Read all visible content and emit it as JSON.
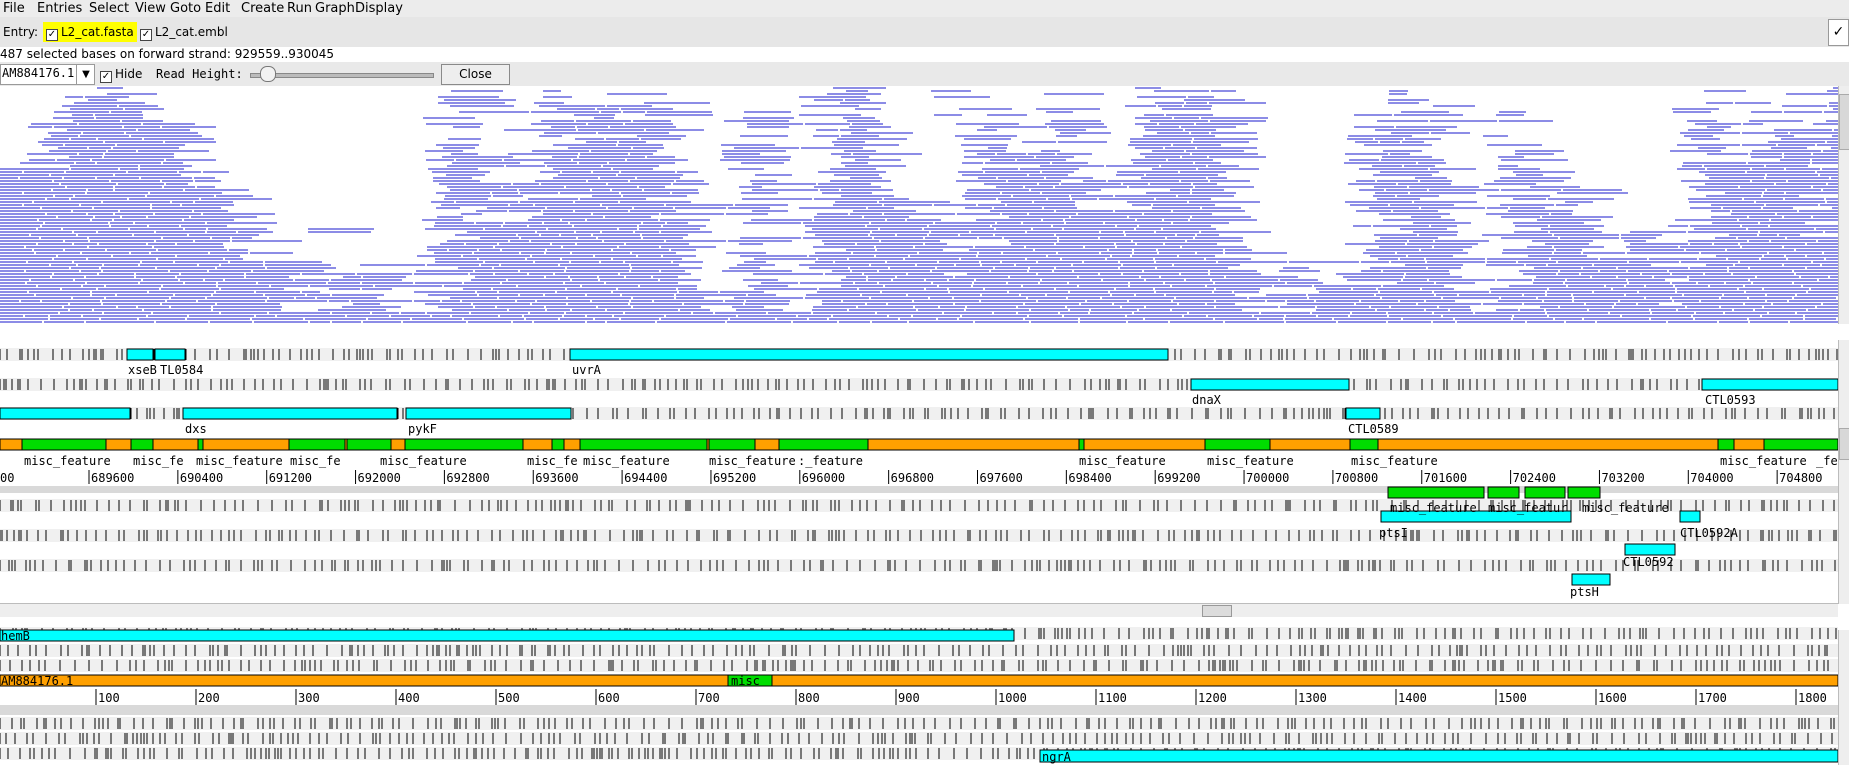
{
  "menu": [
    "File",
    "Entries",
    "Select",
    "View",
    "Goto",
    "Edit",
    "Create",
    "Run",
    "Graph",
    "Display"
  ],
  "entry_bar": {
    "label": "Entry:",
    "entries": [
      {
        "name": "L2_cat.fasta",
        "checked": true,
        "highlight": "#ffff00"
      },
      {
        "name": "L2_cat.embl",
        "checked": true,
        "highlight": ""
      }
    ]
  },
  "status": "487 selected bases on forward strand: 929559..930045",
  "bam_controls": {
    "sequence": "AM884176.1",
    "hide_label": "Hide",
    "hide_checked": true,
    "read_height_label": "Read Height:",
    "close_label": "Close"
  },
  "colors": {
    "cds": "#00ffff",
    "misc_feature": "#00dd00",
    "source": "#ffa000",
    "reads": "#1a1acc"
  },
  "top_view": {
    "ruler_ticks": [
      "689600",
      "690400",
      "691200",
      "692000",
      "692800",
      "693600",
      "694400",
      "695200",
      "696000",
      "696800",
      "697600",
      "698400",
      "699200",
      "700000",
      "700800",
      "701600",
      "702400",
      "703200",
      "704000",
      "704800"
    ],
    "ruler_prefix": "00",
    "labels": [
      "xseB",
      "TL0584",
      "uvrA",
      "dnaX",
      "CTL0593",
      "dxs",
      "pykF",
      "CTL0589",
      "misc_feature",
      "misc_fe",
      "misc_feature",
      "misc_fe",
      "misc_feature",
      "misc_fe",
      "misc_feature",
      "misc_feature",
      ":_feature",
      "misc_feature",
      "misc_feature",
      "misc_feature",
      "misc_feature",
      "_fe",
      "misc_feature",
      "misc_featur",
      "misc_feature",
      "ptsI",
      "CTL0592A",
      "CTL0592",
      "ptsH"
    ]
  },
  "bottom_view": {
    "ruler_ticks": [
      "100",
      "200",
      "300",
      "400",
      "500",
      "600",
      "700",
      "800",
      "900",
      "1000",
      "1100",
      "1200",
      "1300",
      "1400",
      "1500",
      "1600",
      "1700",
      "1800"
    ],
    "labels": [
      "hemB",
      "AM884176.1",
      "misc",
      "ngrA"
    ]
  }
}
